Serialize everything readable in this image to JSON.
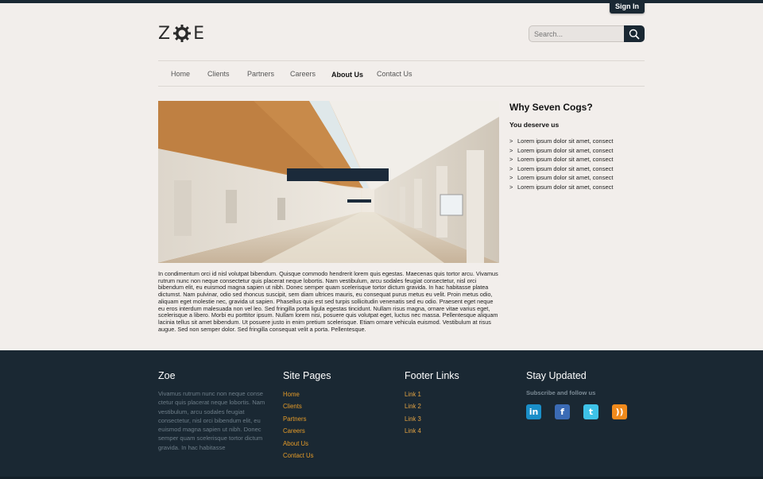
{
  "header": {
    "signin_label": "Sign In",
    "logo_text_left": "Z",
    "logo_text_right": "E",
    "search_placeholder": "Search..."
  },
  "nav": {
    "items": [
      "Home",
      "Clients",
      "Partners",
      "Careers",
      "About Us",
      "Contact Us"
    ],
    "active": "About Us"
  },
  "main": {
    "body": "In condimentum orci id nisl volutpat bibendum. Quisque commodo hendrerit lorem quis egestas. Maecenas quis tortor arcu. Vivamus rutrum nunc non neque consectetur quis placerat neque lobortis. Nam vestibulum, arcu sodales feugiat consectetur, nisl orci bibendum elit, eu euismod magna sapien ut nibh. Donec semper quam scelerisque tortor dictum gravida. In hac habitasse platea dictumst. Nam pulvinar, odio sed rhoncus suscipit, sem diam ultrices mauris, eu consequat purus metus eu velit. Proin metus odio, aliquam eget molestie nec, gravida ut sapien. Phasellus quis est sed turpis sollicitudin venenatis sed eu odio. Praesent eget neque eu eros interdum malesuada non vel leo. Sed fringilla porta ligula egestas tincidunt. Nullam risus magna, ornare vitae varius eget, scelerisque a libero. Morbi eu porttitor ipsum. Nullam lorem nisi, posuere quis volutpat eget, luctus nec massa. Pellentesque aliquam lacinia tellus sit amet bibendum. Ut posuere justo in enim pretium scelerisque. Etiam ornare vehicula euismod. Vestibulum at risus augue. Sed non semper dolor. Sed fringilla consequat velit a porta. Pellentesque."
  },
  "aside": {
    "title": "Why Seven Cogs?",
    "subtitle": "You deserve us",
    "bullet": ">",
    "items": [
      "Lorem ipsum dolor sit amet, consect",
      "Lorem ipsum dolor sit amet, consect",
      "Lorem ipsum dolor sit amet, consect",
      "Lorem ipsum dolor sit amet, consect",
      "Lorem ipsum dolor sit amet, consect",
      "Lorem ipsum dolor sit amet, consect"
    ]
  },
  "footer": {
    "about_title": "Zoe",
    "about_text": "Vivamus rutrum nunc non neque conse ctetur quis placerat neque lobortis. Nam vestibulum, arcu sodales feugiat consectetur, nisl orci bibendum elit, eu euismod magna sapien ut nibh. Donec semper quam scelerisque tortor dictum gravida. In hac habitasse",
    "site_title": "Site Pages",
    "site_links": [
      "Home",
      "Clients",
      "Partners",
      "Careers",
      "About Us",
      "Contact Us"
    ],
    "links_title": "Footer Links",
    "footer_links": [
      "Link 1",
      "Link 2",
      "Link 3",
      "Link 4"
    ],
    "stay_title": "Stay Updated",
    "stay_sub": "Subscribe and follow us",
    "social": [
      {
        "name": "linkedin-icon",
        "glyph": "in",
        "color": "#1a8fc9"
      },
      {
        "name": "facebook-icon",
        "glyph": "f",
        "color": "#3b6bb5"
      },
      {
        "name": "twitter-icon",
        "glyph": "t",
        "color": "#3ec2e8"
      },
      {
        "name": "rss-icon",
        "glyph": "))",
        "color": "#f08a1c"
      }
    ]
  },
  "colors": {
    "page_bg": "#f2eeeb",
    "dark": "#1a2833",
    "accent": "#e59b28"
  }
}
